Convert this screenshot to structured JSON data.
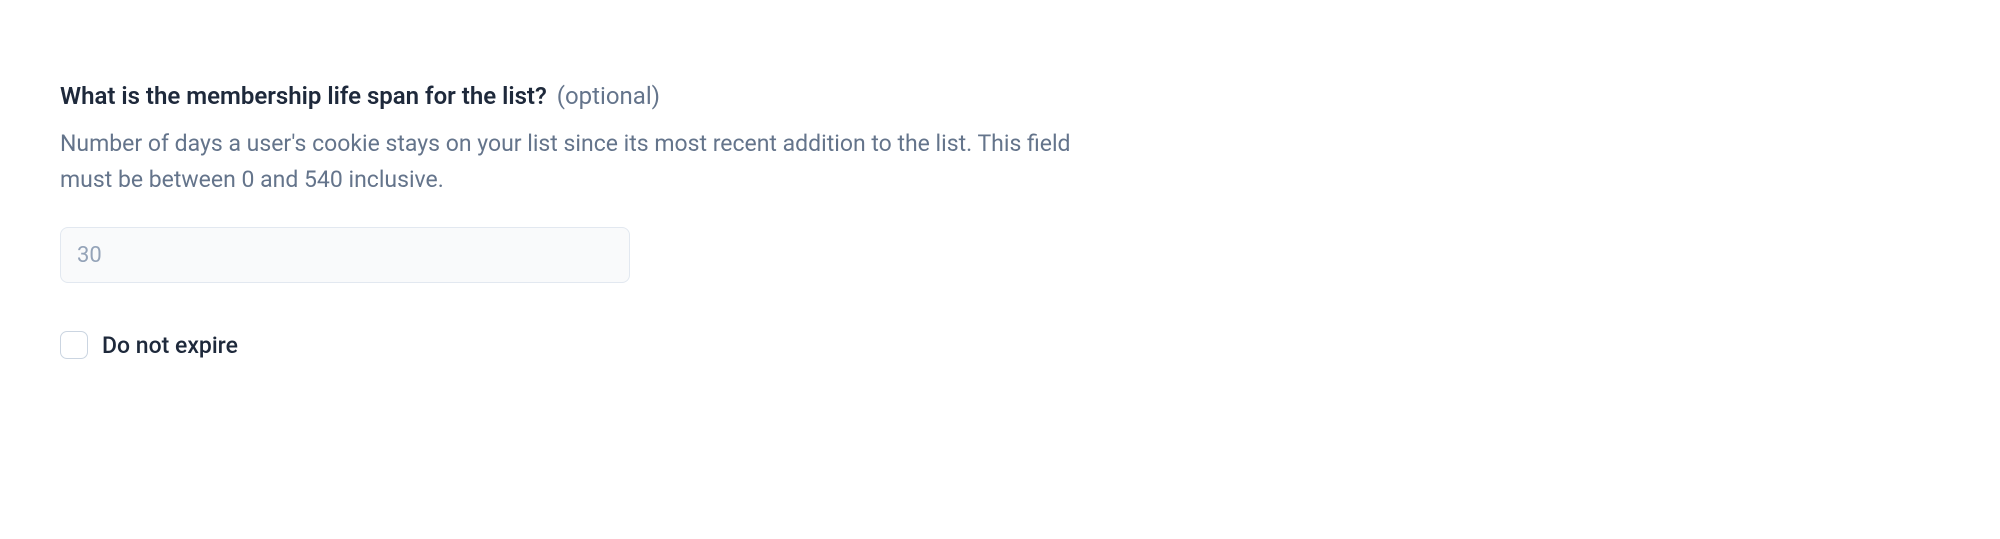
{
  "form": {
    "membership_lifespan": {
      "label": "What is the membership life span for the list?",
      "optional_text": "(optional)",
      "help_text": "Number of days a user's cookie stays on your list since its most recent addition to the list. This field must be between 0 and 540 inclusive.",
      "placeholder": "30",
      "value": ""
    },
    "do_not_expire": {
      "label": "Do not expire",
      "checked": false
    }
  }
}
